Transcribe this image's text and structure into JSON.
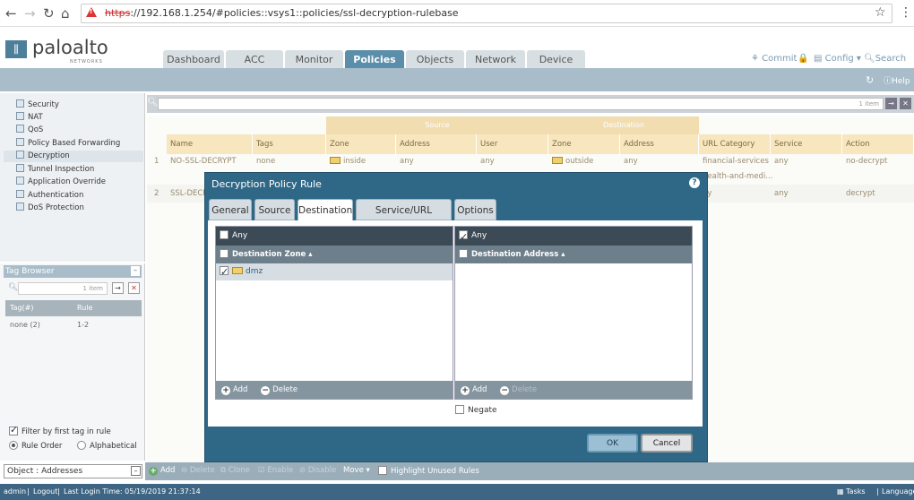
{
  "browser": {
    "url_scheme": "https",
    "url_rest": "://192.168.1.254/#policies::vsys1::policies/ssl-decryption-rulebase"
  },
  "header": {
    "logo_text": "paloalto",
    "logo_sub": "NETWORKS",
    "tabs": [
      "Dashboard",
      "ACC",
      "Monitor",
      "Policies",
      "Objects",
      "Network",
      "Device"
    ],
    "active_tab": "Policies",
    "commit": "Commit",
    "config": "Config",
    "search": "Search",
    "help": "Help"
  },
  "sidebar": {
    "items": [
      "Security",
      "NAT",
      "QoS",
      "Policy Based Forwarding",
      "Decryption",
      "Tunnel Inspection",
      "Application Override",
      "Authentication",
      "DoS Protection"
    ],
    "selected": "Decryption"
  },
  "tag_browser": {
    "title": "Tag Browser",
    "search_count": "1 item",
    "columns": [
      "Tag(#)",
      "Rule"
    ],
    "rows": [
      {
        "tag": "none (2)",
        "rule": "1-2"
      }
    ],
    "filter_label": "Filter by first tag in rule",
    "rule_order": "Rule Order",
    "alphabetical": "Alphabetical"
  },
  "object_bar": "Object : Addresses",
  "rulebase": {
    "search_count": "1 item",
    "group_source": "Source",
    "group_destination": "Destination",
    "columns": [
      "Name",
      "Tags",
      "Zone",
      "Address",
      "User",
      "Zone",
      "Address",
      "URL Category",
      "Service",
      "Action"
    ],
    "rows": [
      {
        "num": "1",
        "name": "NO-SSL-DECRYPT",
        "tags": "none",
        "src_zone": "inside",
        "src_addr": "any",
        "user": "any",
        "dst_zone": "outside",
        "dst_addr": "any",
        "url": "financial-services",
        "url2": "health-and-medi...",
        "service": "any",
        "action": "no-decrypt"
      },
      {
        "num": "2",
        "name": "SSL-DECR",
        "tags": "",
        "src_zone": "",
        "src_addr": "",
        "user": "",
        "dst_zone": "",
        "dst_addr": "",
        "url": "ny",
        "url2": "",
        "service": "any",
        "action": "decrypt"
      }
    ]
  },
  "bottom_toolbar": {
    "add": "Add",
    "delete": "Delete",
    "clone": "Clone",
    "enable": "Enable",
    "disable": "Disable",
    "move": "Move",
    "highlight": "Highlight Unused Rules"
  },
  "status": {
    "user": "admin",
    "logout": "Logout",
    "last_login": "Last Login Time: 05/19/2019 21:37:14",
    "tasks": "Tasks",
    "language": "Language"
  },
  "dialog": {
    "title": "Decryption Policy Rule",
    "tabs": [
      "General",
      "Source",
      "Destination",
      "Service/URL Category",
      "Options"
    ],
    "active_tab": "Destination",
    "left_panel": {
      "any_label": "Any",
      "any_checked": false,
      "column": "Destination Zone",
      "items": [
        {
          "label": "dmz",
          "checked": true
        }
      ],
      "add": "Add",
      "delete": "Delete"
    },
    "right_panel": {
      "any_label": "Any",
      "any_checked": true,
      "column": "Destination Address",
      "add": "Add",
      "delete": "Delete"
    },
    "negate": "Negate",
    "ok": "OK",
    "cancel": "Cancel"
  }
}
